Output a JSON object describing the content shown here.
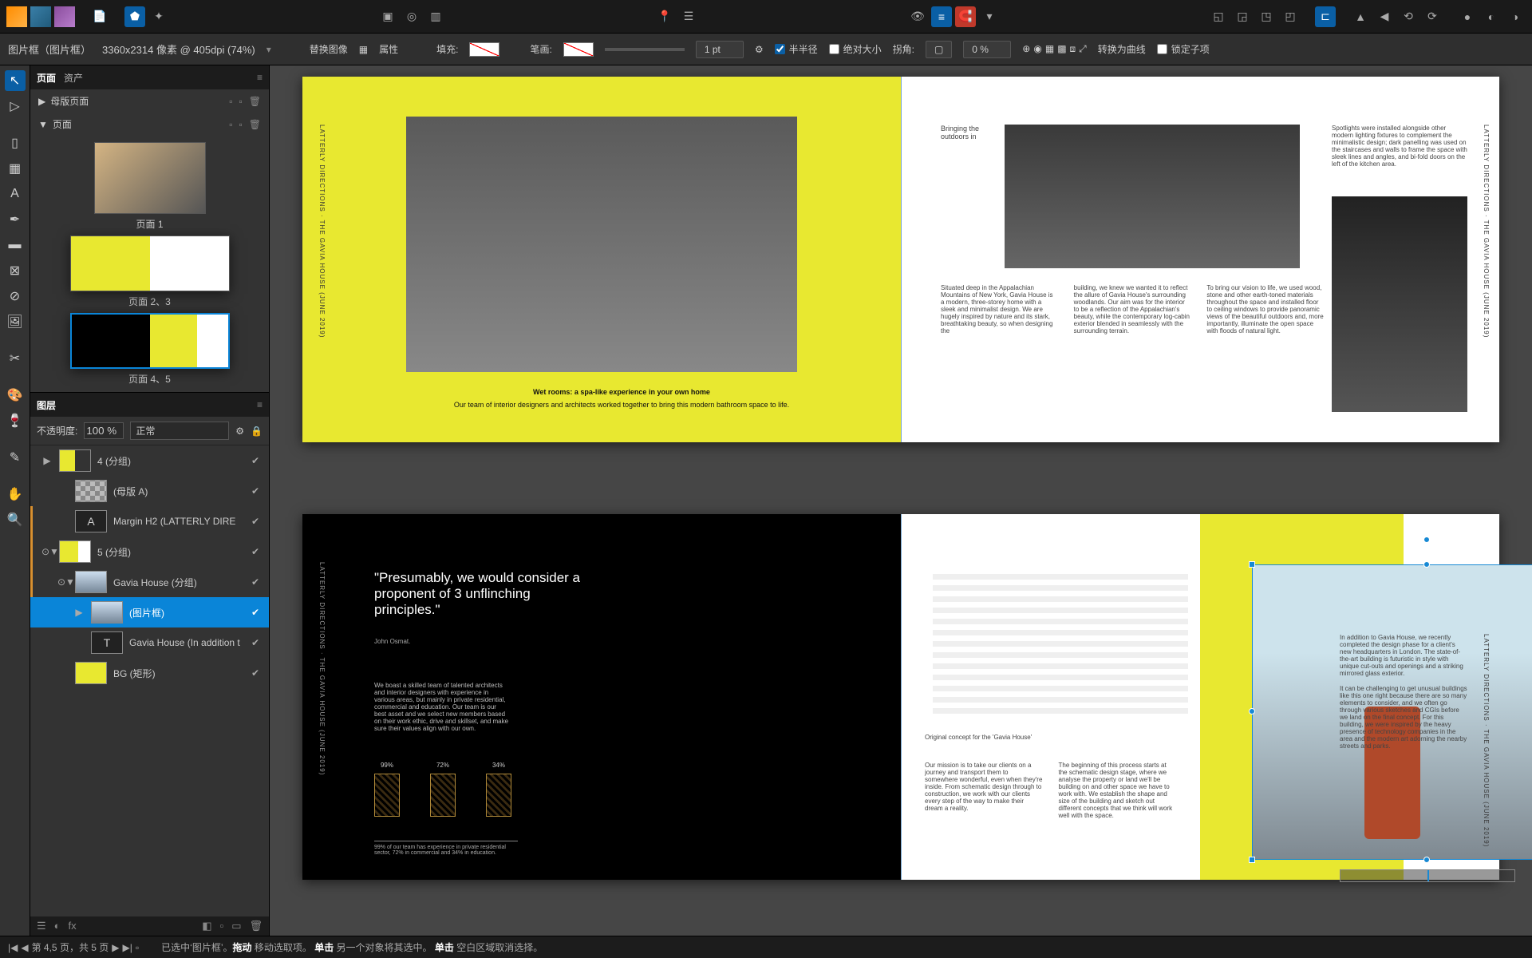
{
  "topbar": {
    "personas": [
      "publisher",
      "designer",
      "photo"
    ]
  },
  "optionsbar": {
    "context": "图片框（图片框）",
    "dims": "3360x2314 像素 @ 405dpi (74%)",
    "replace": "替换图像",
    "props": "属性",
    "fill": "填充:",
    "stroke": "笔画:",
    "strokeval": "1 pt",
    "half": "半半径",
    "abssize": "绝对大小",
    "corner": "拐角:",
    "cornerval": "0 %",
    "curve": "转换为曲线",
    "lockkids": "锁定子项"
  },
  "panels": {
    "pages_tab": "页面",
    "assets_tab": "资产",
    "master_pages": "母版页面",
    "pages_section": "页面",
    "page1": "页面 1",
    "page23": "页面 2、3",
    "page45": "页面 4、5",
    "layers_tab": "图层",
    "opacity_label": "不透明度:",
    "opacity_val": "100 %",
    "blend": "正常"
  },
  "layers": [
    {
      "name": "4 (分组)",
      "indent": 0,
      "toggle": "▶",
      "icon": "grp1",
      "sel": false
    },
    {
      "name": "(母版 A)",
      "indent": 1,
      "toggle": "",
      "icon": "master",
      "sel": false
    },
    {
      "name": "Margin H2 (LATTERLY DIRE",
      "indent": 1,
      "toggle": "",
      "icon": "A",
      "sel": false,
      "sideline": true
    },
    {
      "name": "5 (分组)",
      "indent": 0,
      "toggle": "⊙▼",
      "icon": "grp2",
      "sel": false,
      "sideline": true
    },
    {
      "name": "Gavia House (分组)",
      "indent": 1,
      "toggle": "⊙▼",
      "icon": "gavia",
      "sel": false,
      "sideline": true
    },
    {
      "name": "(图片框)",
      "indent": 2,
      "toggle": "▶",
      "icon": "pic",
      "sel": true
    },
    {
      "name": "Gavia House (In addition t",
      "indent": 2,
      "toggle": "",
      "icon": "T",
      "sel": false
    },
    {
      "name": "BG (矩形)",
      "indent": 1,
      "toggle": "",
      "icon": "bg",
      "sel": false
    }
  ],
  "spreads": {
    "s1": {
      "vtext": "LATTERLY DIRECTIONS · THE GAVIA HOUSE (JUNE 2019)",
      "caption_bold": "Wet rooms: a spa-like experience in your own home",
      "caption": "Our team of interior designers and architects worked together to bring this modern bathroom space to life."
    },
    "s2": {
      "head": "Bringing the outdoors in",
      "side": "Spotlights were installed alongside other modern lighting fixtures to complement the minimalistic design; dark panelling was used on the staircases and walls to frame the space with sleek lines and angles, and bi-fold doors on the left of the kitchen area.",
      "col1": "Situated deep in the Appalachian Mountains of New York, Gavia House is a modern, three-storey home with a sleek and minimalist design.  We are hugely inspired by nature and its stark, breathtaking beauty, so when designing the",
      "col2": "building, we knew we wanted it to reflect the allure of Gavia House's surrounding woodlands. Our aim was for the interior to be a reflection of the Appalachian's beauty, while the contemporary log-cabin exterior blended in seamlessly with the surrounding terrain.",
      "col3": "To bring our vision to life, we used wood, stone and other earth-toned materials throughout the space and installed floor to ceiling windows to provide panoramic views of the beautiful outdoors and, more importantly, illuminate the open space with floods of natural light.",
      "vtext": "LATTERLY DIRECTIONS · THE GAVIA HOUSE (JUNE 2019)"
    },
    "s3": {
      "quote": "\"Presumably, we would consider a proponent of 3 unflinching principles.\"",
      "attr": "John Osmat.",
      "body": "We boast a skilled team of talented architects and interior designers with experience in various areas, but mainly in private residential, commercial and education. Our team is our best asset and we select new members based on their work ethic, drive and skillset, and make sure their values align with our own.",
      "pct": [
        "99%",
        "72%",
        "34%"
      ],
      "foot": "99% of our team has experience in private residential sector, 72% in commercial and 34% in education.",
      "vtext": "LATTERLY DIRECTIONS · THE GAVIA HOUSE (JUNE 2019)"
    },
    "s4": {
      "cap": "Original concept for the 'Gavia House'",
      "col1": "Our mission is to take our clients on a journey and transport them to somewhere wonderful, even when they're inside. From schematic design through to construction, we work with our clients every step of the way to make their dream a reality.",
      "col2": "The beginning of this process starts at the schematic design stage, where we analyse the property or land we'll be building on and other space we have to work with. We establish the shape and size of the building and sketch out different concepts that we think will work well with the space."
    },
    "s5": {
      "p1": "In addition to Gavia House, we recently completed the design phase for a client's new headquarters in London. The state-of-the-art building is futuristic in style with unique cut-outs and openings and a striking mirrored glass exterior.",
      "p2": "It can be challenging to get unusual buildings like this one right because there are so many elements to consider, and we often go through various sketches and CGIs before we land on the final concept. For this building, we were inspired by the heavy presence of technology companies in the area and the modern art adorning the nearby streets and parks.",
      "vtext": "LATTERLY DIRECTIONS · THE GAVIA HOUSE (JUNE 2019)"
    }
  },
  "status": {
    "nav": "第 4,5 页，共 5 页",
    "hint1a": "已选中‘图片框’。",
    "hint1b": "拖动",
    "hint1c": " 移动选取项。",
    "hint2a": "单击",
    "hint2b": " 另一个对象将其选中。",
    "hint3a": "单击",
    "hint3b": " 空白区域取消选择。"
  }
}
